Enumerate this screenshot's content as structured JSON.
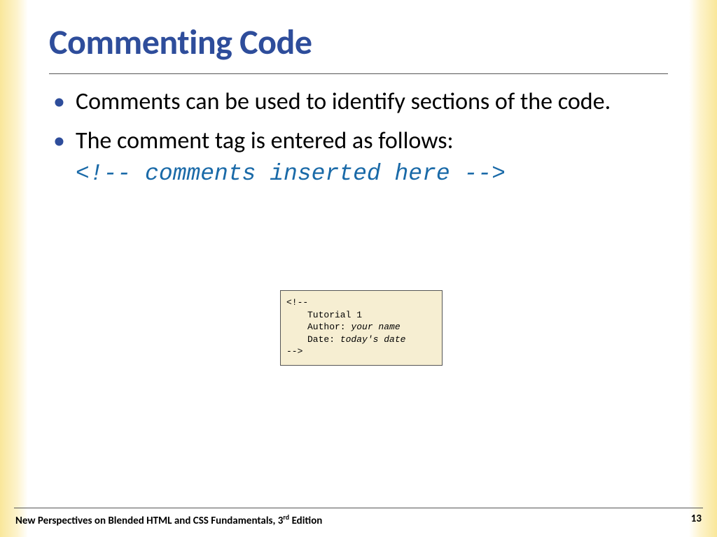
{
  "title": "Commenting Code",
  "bullets": [
    {
      "text": "Comments can be used to identify sections of the code."
    },
    {
      "text": "The comment tag is entered as follows:",
      "code": "<!-- comments inserted here -->"
    }
  ],
  "example": {
    "open": "<!--",
    "line1_label": "Tutorial 1",
    "line2_label": "Author: ",
    "line2_value": "your name",
    "line3_label": "Date: ",
    "line3_value": "today's date",
    "close": "-->"
  },
  "footer": {
    "book_prefix": "New Perspectives on Blended HTML and CSS Fundamentals, 3",
    "book_suffix": " Edition",
    "ord": "rd",
    "page": "13"
  }
}
